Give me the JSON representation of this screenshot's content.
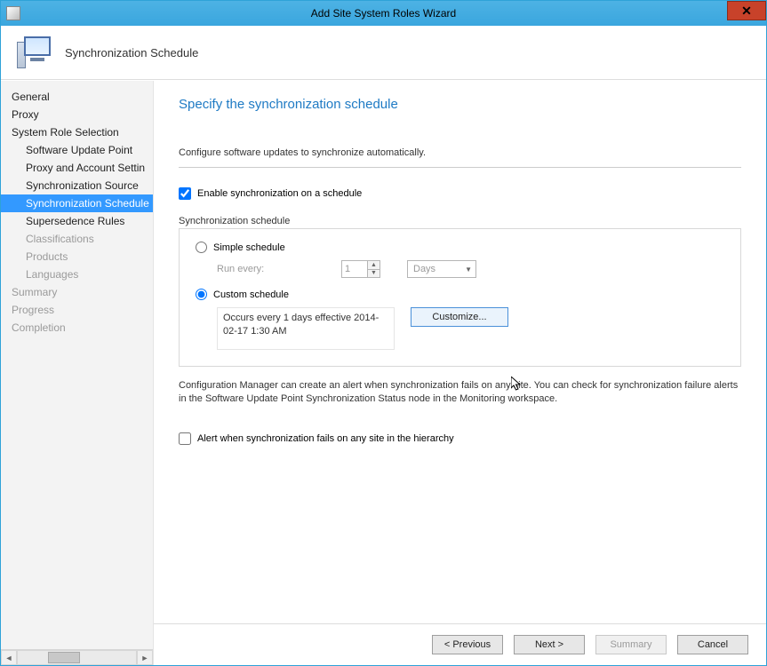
{
  "window": {
    "title": "Add Site System Roles Wizard"
  },
  "banner": {
    "page_name": "Synchronization Schedule"
  },
  "sidebar": {
    "items": [
      {
        "label": "General",
        "child": false,
        "selected": false,
        "disabled": false
      },
      {
        "label": "Proxy",
        "child": false,
        "selected": false,
        "disabled": false
      },
      {
        "label": "System Role Selection",
        "child": false,
        "selected": false,
        "disabled": false
      },
      {
        "label": "Software Update Point",
        "child": true,
        "selected": false,
        "disabled": false
      },
      {
        "label": "Proxy and Account Settin",
        "child": true,
        "selected": false,
        "disabled": false
      },
      {
        "label": "Synchronization Source",
        "child": true,
        "selected": false,
        "disabled": false
      },
      {
        "label": "Synchronization Schedule",
        "child": true,
        "selected": true,
        "disabled": false
      },
      {
        "label": "Supersedence Rules",
        "child": true,
        "selected": false,
        "disabled": false
      },
      {
        "label": "Classifications",
        "child": true,
        "selected": false,
        "disabled": true
      },
      {
        "label": "Products",
        "child": true,
        "selected": false,
        "disabled": true
      },
      {
        "label": "Languages",
        "child": true,
        "selected": false,
        "disabled": true
      },
      {
        "label": "Summary",
        "child": false,
        "selected": false,
        "disabled": true
      },
      {
        "label": "Progress",
        "child": false,
        "selected": false,
        "disabled": true
      },
      {
        "label": "Completion",
        "child": false,
        "selected": false,
        "disabled": true
      }
    ]
  },
  "main": {
    "title": "Specify the synchronization schedule",
    "description": "Configure software updates to synchronize automatically.",
    "enable_checkbox": {
      "label": "Enable synchronization on a schedule",
      "checked": true
    },
    "schedule_group_label": "Synchronization schedule",
    "simple_radio": {
      "label": "Simple schedule",
      "checked": false,
      "run_every_label": "Run every:",
      "run_every_value": "1",
      "run_every_unit": "Days"
    },
    "custom_radio": {
      "label": "Custom schedule",
      "checked": true,
      "summary_text": "Occurs every 1 days effective 2014-02-17 1:30 AM",
      "customize_button": "Customize..."
    },
    "info_text": "Configuration Manager can create an alert when synchronization fails on any site. You can check for synchronization failure alerts in the Software Update Point Synchronization Status node in the Monitoring workspace.",
    "alert_checkbox": {
      "label": "Alert when synchronization fails on any site in the hierarchy",
      "checked": false
    }
  },
  "footer": {
    "previous": "< Previous",
    "next": "Next >",
    "summary": "Summary",
    "cancel": "Cancel"
  }
}
